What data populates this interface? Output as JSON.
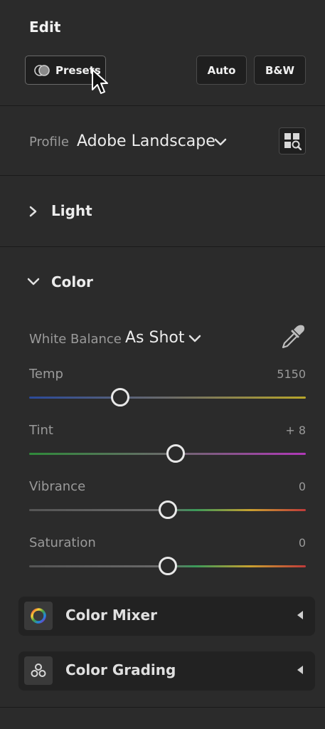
{
  "header": {
    "title": "Edit"
  },
  "toolbar": {
    "presets_label": "Presets",
    "auto_label": "Auto",
    "bw_label": "B&W"
  },
  "profile": {
    "label": "Profile",
    "value": "Adobe Landscape",
    "browse_icon": "grid-search-icon"
  },
  "sections": {
    "light": "Light",
    "color": "Color"
  },
  "white_balance": {
    "label": "White Balance",
    "value": "As Shot",
    "picker_icon": "eyedropper-icon"
  },
  "sliders": [
    {
      "label": "Temp",
      "value": "5150",
      "position": 0.33
    },
    {
      "label": "Tint",
      "value": "+ 8",
      "position": 0.53
    },
    {
      "label": "Vibrance",
      "value": "0",
      "position": 0.5
    },
    {
      "label": "Saturation",
      "value": "0",
      "position": 0.5
    }
  ],
  "panels": {
    "mixer": "Color Mixer",
    "grading": "Color Grading"
  },
  "colors": {
    "background": "#2b2b2b",
    "panel": "#222222",
    "text": "#e6e6e6",
    "muted": "#9a9a9a"
  }
}
